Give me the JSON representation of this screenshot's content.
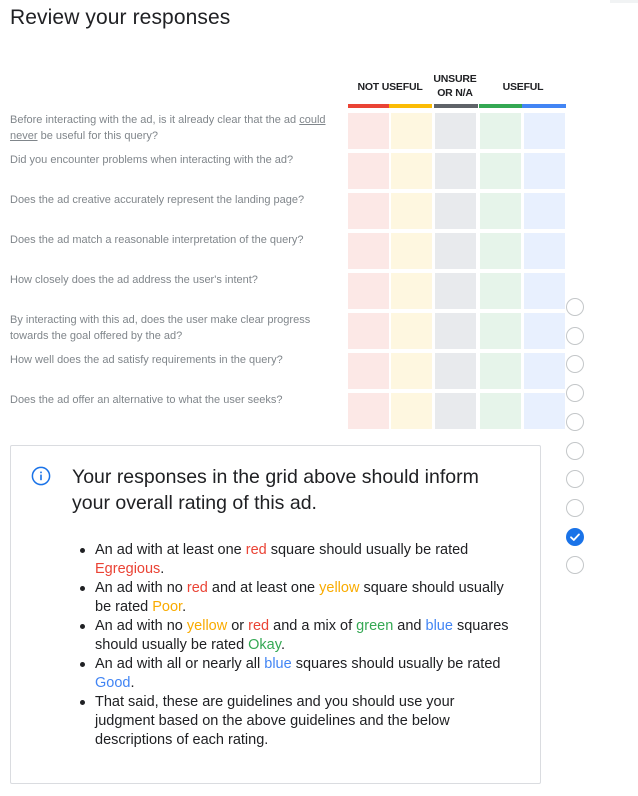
{
  "title": "Review your responses",
  "columns": {
    "not_useful": "NOT USEFUL",
    "unsure_line1": "UNSURE",
    "unsure_line2": "OR N/A",
    "useful": "USEFUL"
  },
  "colors": {
    "red": "#ea4335",
    "yellow": "#fbbc04",
    "grey": "#5f6368",
    "green": "#34a853",
    "blue": "#4285f4",
    "cell_red": "#fce8e6",
    "cell_yellow": "#fef7e0",
    "cell_grey": "#e8eaed",
    "cell_green": "#e6f4ea",
    "cell_blue": "#e8f0fe",
    "checked_radio": "#1a73e8"
  },
  "questions": [
    {
      "pre": "Before interacting with the ad, is it already clear that the ad ",
      "underlined": "could never",
      "post": " be useful for this query?"
    },
    {
      "pre": "Did you encounter problems when interacting with the ad?",
      "underlined": "",
      "post": ""
    },
    {
      "pre": "Does the ad creative accurately represent the landing page?",
      "underlined": "",
      "post": ""
    },
    {
      "pre": "Does the ad match a reasonable interpretation of the query?",
      "underlined": "",
      "post": ""
    },
    {
      "pre": "How closely does the ad address the user's intent?",
      "underlined": "",
      "post": ""
    },
    {
      "pre": "By interacting with this ad, does the user make clear progress towards the goal offered by the ad?",
      "underlined": "",
      "post": ""
    },
    {
      "pre": "How well does the ad satisfy requirements in the query?",
      "underlined": "",
      "post": ""
    },
    {
      "pre": "Does the ad offer an alternative to what the user seeks?",
      "underlined": "",
      "post": ""
    }
  ],
  "rating_options": {
    "count": 10,
    "selected_index": 8
  },
  "info": {
    "icon": "info-icon",
    "title": "Your responses in the grid above should inform your overall rating of this ad.",
    "bullets": [
      [
        {
          "t": "An ad with at least one "
        },
        {
          "t": "red",
          "c": "c-red"
        },
        {
          "t": " square should usually be rated "
        },
        {
          "t": "Egregious",
          "c": "c-egregious"
        },
        {
          "t": "."
        }
      ],
      [
        {
          "t": "An ad with no "
        },
        {
          "t": "red",
          "c": "c-red"
        },
        {
          "t": " and at least one "
        },
        {
          "t": "yellow",
          "c": "c-yellow"
        },
        {
          "t": " square should usually be rated "
        },
        {
          "t": "Poor",
          "c": "c-poor"
        },
        {
          "t": "."
        }
      ],
      [
        {
          "t": "An ad with no "
        },
        {
          "t": "yellow",
          "c": "c-yellow"
        },
        {
          "t": " or "
        },
        {
          "t": "red",
          "c": "c-red"
        },
        {
          "t": " and a mix of "
        },
        {
          "t": "green",
          "c": "c-green"
        },
        {
          "t": " and "
        },
        {
          "t": "blue",
          "c": "c-blue"
        },
        {
          "t": " squares should usually be rated "
        },
        {
          "t": "Okay",
          "c": "c-okay"
        },
        {
          "t": "."
        }
      ],
      [
        {
          "t": "An ad with all or nearly all "
        },
        {
          "t": "blue",
          "c": "c-blue"
        },
        {
          "t": " squares should usually be rated "
        },
        {
          "t": "Good",
          "c": "c-good"
        },
        {
          "t": "."
        }
      ],
      [
        {
          "t": "That said, these are guidelines and you should use your judgment based on the above guidelines and the below descriptions of each rating."
        }
      ]
    ]
  }
}
